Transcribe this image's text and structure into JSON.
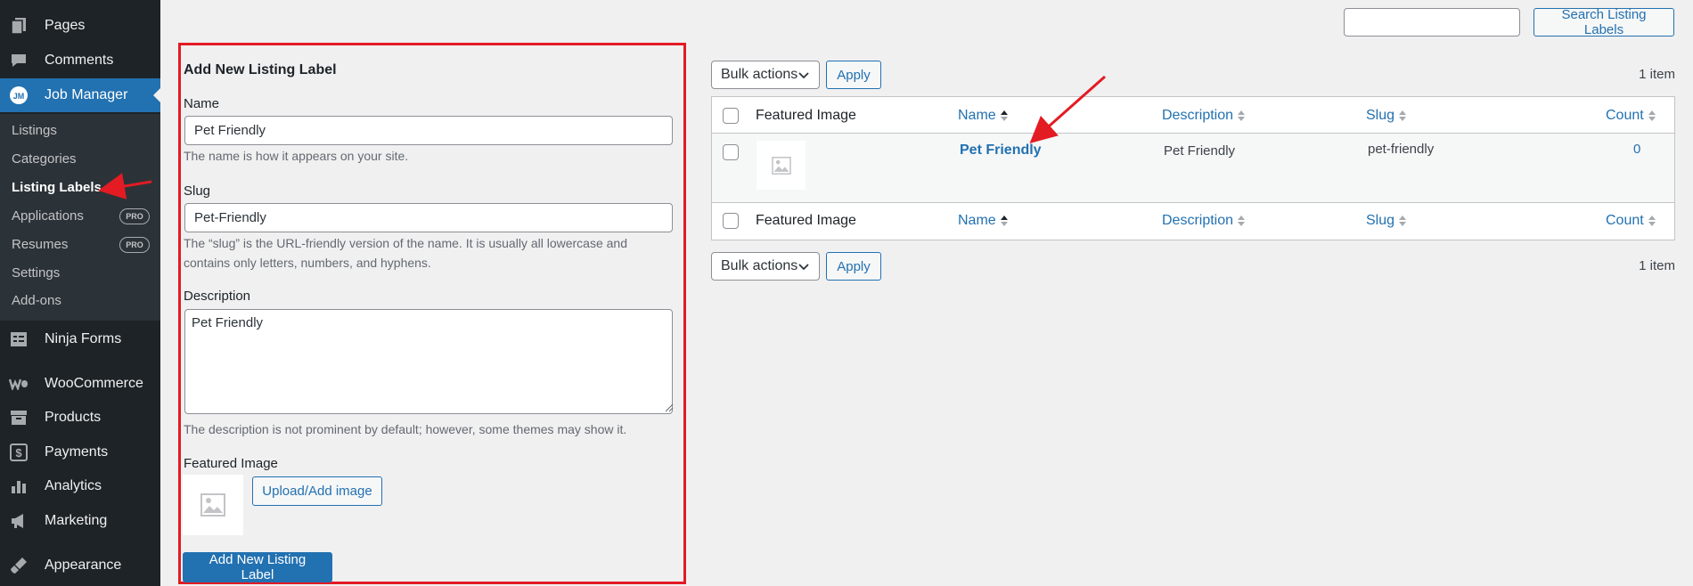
{
  "sidebar": {
    "menu": [
      {
        "label": "Pages",
        "icon": "pages-icon"
      },
      {
        "label": "Comments",
        "icon": "comments-icon"
      },
      {
        "label": "Job Manager",
        "icon": "job-manager-icon",
        "active": true
      },
      {
        "label": "Ninja Forms",
        "icon": "ninja-forms-icon"
      },
      {
        "label": "WooCommerce",
        "icon": "woocommerce-icon"
      },
      {
        "label": "Products",
        "icon": "products-icon"
      },
      {
        "label": "Payments",
        "icon": "payments-icon"
      },
      {
        "label": "Analytics",
        "icon": "analytics-icon"
      },
      {
        "label": "Marketing",
        "icon": "marketing-icon"
      },
      {
        "label": "Appearance",
        "icon": "appearance-icon"
      }
    ],
    "job_manager_logo": "JM",
    "submenu": [
      {
        "label": "Listings"
      },
      {
        "label": "Categories"
      },
      {
        "label": "Listing Labels",
        "current": true
      },
      {
        "label": "Applications",
        "badge": "PRO"
      },
      {
        "label": "Resumes",
        "badge": "PRO"
      },
      {
        "label": "Settings"
      },
      {
        "label": "Add-ons"
      }
    ]
  },
  "form": {
    "title": "Add New Listing Label",
    "name_label": "Name",
    "name_value": "Pet Friendly",
    "name_help": "The name is how it appears on your site.",
    "slug_label": "Slug",
    "slug_value": "Pet-Friendly",
    "slug_help_line1": "The “slug” is the URL-friendly version of the name. It is usually all lowercase and",
    "slug_help_line2": "contains only letters, numbers, and hyphens.",
    "description_label": "Description",
    "description_value": "Pet Friendly",
    "description_help": "The description is not prominent by default; however, some themes may show it.",
    "featured_image_label": "Featured Image",
    "upload_button": "Upload/Add image",
    "submit_button": "Add New Listing Label"
  },
  "search": {
    "button": "Search Listing Labels",
    "value": ""
  },
  "bulk": {
    "select_label": "Bulk actions",
    "apply_label": "Apply",
    "items_count": "1 item"
  },
  "table": {
    "columns": {
      "featured_image": "Featured Image",
      "name": "Name",
      "description": "Description",
      "slug": "Slug",
      "count": "Count"
    },
    "rows": [
      {
        "name": "Pet Friendly",
        "description": "Pet Friendly",
        "slug": "pet-friendly",
        "count": "0"
      }
    ]
  },
  "colors": {
    "accent": "#2271b1",
    "highlight_border": "#e31b23",
    "sidebar_bg": "#1d2327"
  }
}
